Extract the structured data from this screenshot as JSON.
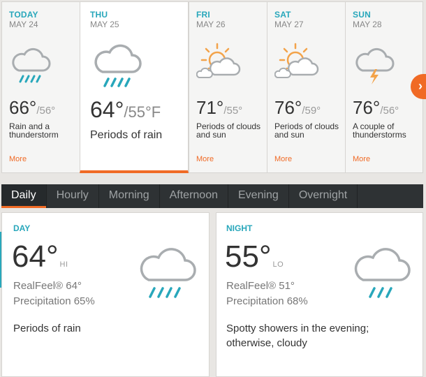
{
  "days": [
    {
      "name": "TODAY",
      "date": "MAY 24",
      "hi": "66°",
      "lo": "/56°",
      "phrase": "Rain and a thunderstorm",
      "more": "More",
      "icon": "rain-cloud-icon"
    },
    {
      "name": "THU",
      "date": "MAY 25",
      "hi": "64°",
      "lo": "/55°F",
      "phrase": "Periods of rain",
      "more": "",
      "icon": "rain-cloud-icon"
    },
    {
      "name": "FRI",
      "date": "MAY 26",
      "hi": "71°",
      "lo": "/55°",
      "phrase": "Periods of clouds and sun",
      "more": "More",
      "icon": "partly-sunny-icon"
    },
    {
      "name": "SAT",
      "date": "MAY 27",
      "hi": "76°",
      "lo": "/59°",
      "phrase": "Periods of clouds and sun",
      "more": "More",
      "icon": "partly-sunny-icon"
    },
    {
      "name": "SUN",
      "date": "MAY 28",
      "hi": "76°",
      "lo": "/56°",
      "phrase": "A couple of thunderstorms",
      "more": "More",
      "icon": "thunderstorm-icon"
    }
  ],
  "next_arrow": "›",
  "tabs": [
    "Daily",
    "Hourly",
    "Morning",
    "Afternoon",
    "Evening",
    "Overnight"
  ],
  "active_tab": "Daily",
  "day_panel": {
    "label": "DAY",
    "temp": "64°",
    "tag": "HI",
    "realfeel": "RealFeel® 64°",
    "precip": "Precipitation 65%",
    "phrase": "Periods of rain",
    "icon": "rain-cloud-icon"
  },
  "night_panel": {
    "label": "NIGHT",
    "temp": "55°",
    "tag": "LO",
    "realfeel": "RealFeel® 51°",
    "precip": "Precipitation 68%",
    "phrase": "Spotty showers in the evening; otherwise, cloudy",
    "icon": "showers-cloud-icon"
  },
  "colors": {
    "accent": "#f06a25",
    "teal": "#28a7bb",
    "tabbar": "#2e3234"
  }
}
